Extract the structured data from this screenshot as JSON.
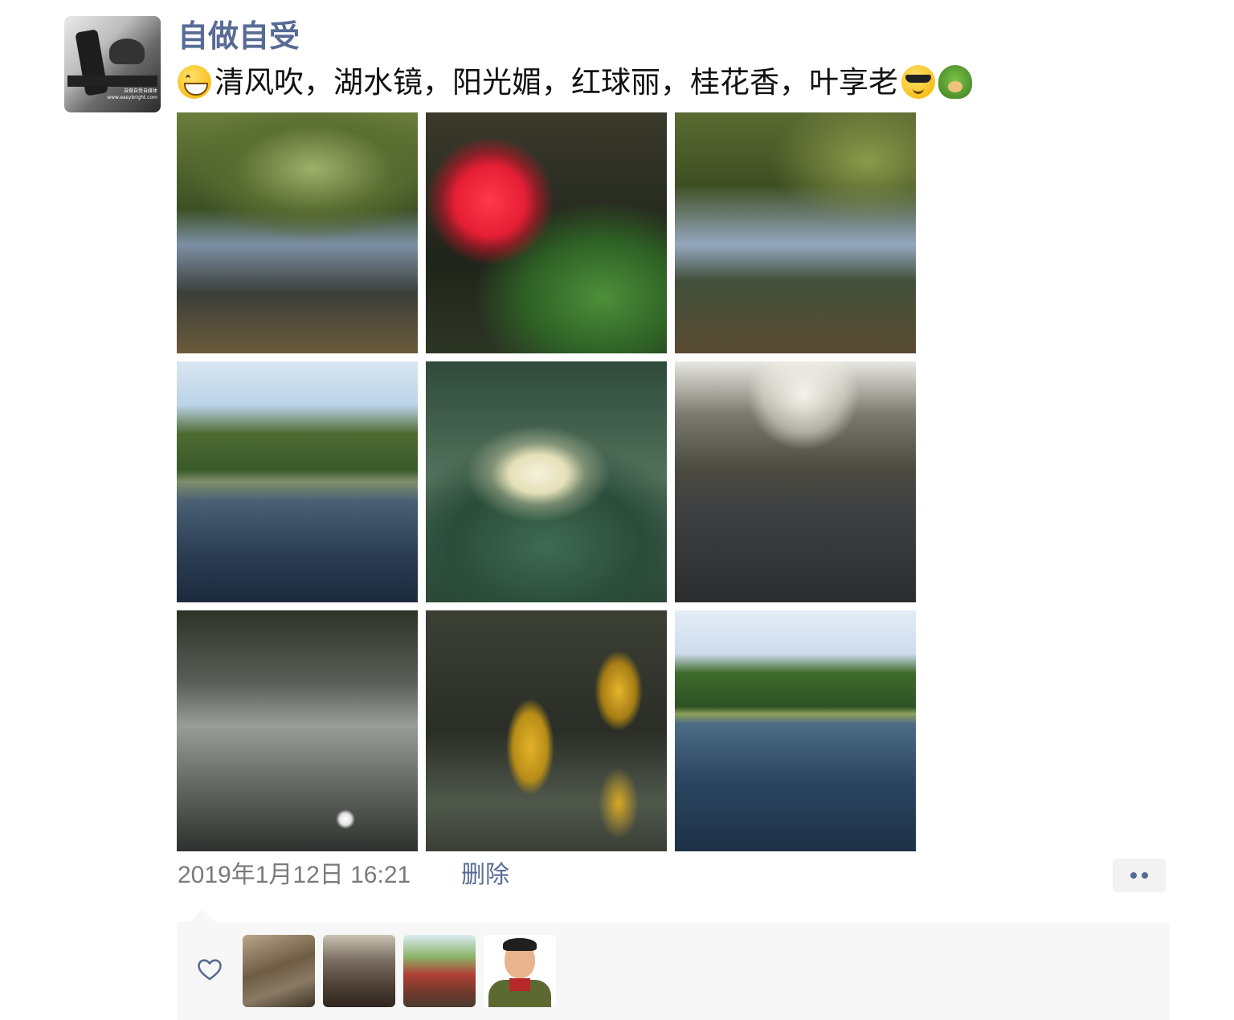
{
  "post": {
    "username": "自做自受",
    "text": "清风吹，湖水镜，阳光媚，红球丽，桂花香，叶享老",
    "emojis": [
      "grinning-face-icon",
      "sunglasses-face-icon",
      "turtle-icon"
    ],
    "avatar_caption": "自做自受自媒体 www.easybright.com"
  },
  "photos": [
    {
      "subject": "lake-trees"
    },
    {
      "subject": "red-flower"
    },
    {
      "subject": "lake-trees"
    },
    {
      "subject": "lake-reflection"
    },
    {
      "subject": "osmanthus-flower"
    },
    {
      "subject": "park-road"
    },
    {
      "subject": "lake-sunset"
    },
    {
      "subject": "yellow-leaves"
    },
    {
      "subject": "lake-forest"
    }
  ],
  "meta": {
    "timestamp": "2019年1月12日 16:21",
    "delete_label": "删除"
  },
  "colors": {
    "link": "#576b95",
    "time": "#7a7a7a",
    "panel_bg": "#f7f7f7"
  },
  "likes": {
    "icon": "heart-outline-icon",
    "count": 4
  }
}
